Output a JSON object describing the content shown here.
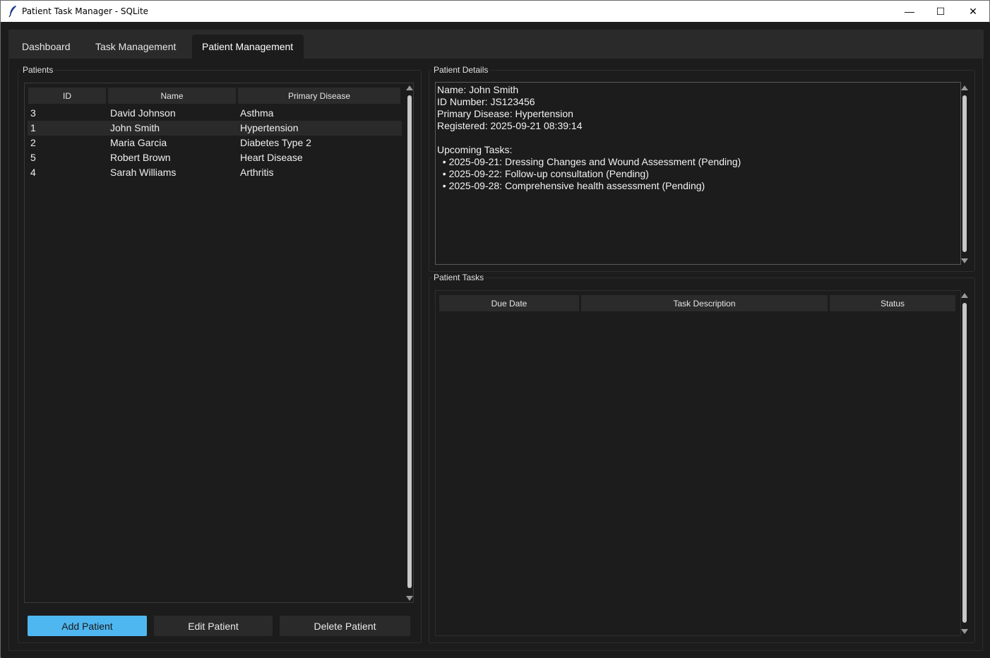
{
  "window": {
    "title": "Patient Task Manager - SQLite",
    "controls": {
      "minimize": "—",
      "maximize": "☐",
      "close": "✕"
    }
  },
  "tabs": [
    {
      "label": "Dashboard"
    },
    {
      "label": "Task Management"
    },
    {
      "label": "Patient Management",
      "active": true
    }
  ],
  "patients_panel": {
    "label": "Patients",
    "columns": [
      "ID",
      "Name",
      "Primary Disease"
    ],
    "rows": [
      {
        "id": "3",
        "name": "David Johnson",
        "disease": "Asthma"
      },
      {
        "id": "1",
        "name": "John Smith",
        "disease": "Hypertension",
        "selected": true
      },
      {
        "id": "2",
        "name": "Maria Garcia",
        "disease": "Diabetes Type 2"
      },
      {
        "id": "5",
        "name": "Robert Brown",
        "disease": "Heart Disease"
      },
      {
        "id": "4",
        "name": "Sarah Williams",
        "disease": "Arthritis"
      }
    ],
    "buttons": {
      "add": "Add Patient",
      "edit": "Edit Patient",
      "delete": "Delete Patient"
    }
  },
  "details_panel": {
    "label": "Patient Details",
    "lines": [
      "Name: John Smith",
      "ID Number: JS123456",
      "Primary Disease: Hypertension",
      "Registered: 2025-09-21 08:39:14",
      "",
      "Upcoming Tasks:",
      "  • 2025-09-21: Dressing Changes and Wound Assessment (Pending)",
      "  • 2025-09-22: Follow-up consultation (Pending)",
      "  • 2025-09-28: Comprehensive health assessment (Pending)"
    ]
  },
  "tasks_panel": {
    "label": "Patient Tasks",
    "columns": [
      "Due Date",
      "Task Description",
      "Status"
    ]
  },
  "colors": {
    "accent": "#4fb7f0",
    "background": "#1c1c1c",
    "header": "#2b2b2b"
  }
}
